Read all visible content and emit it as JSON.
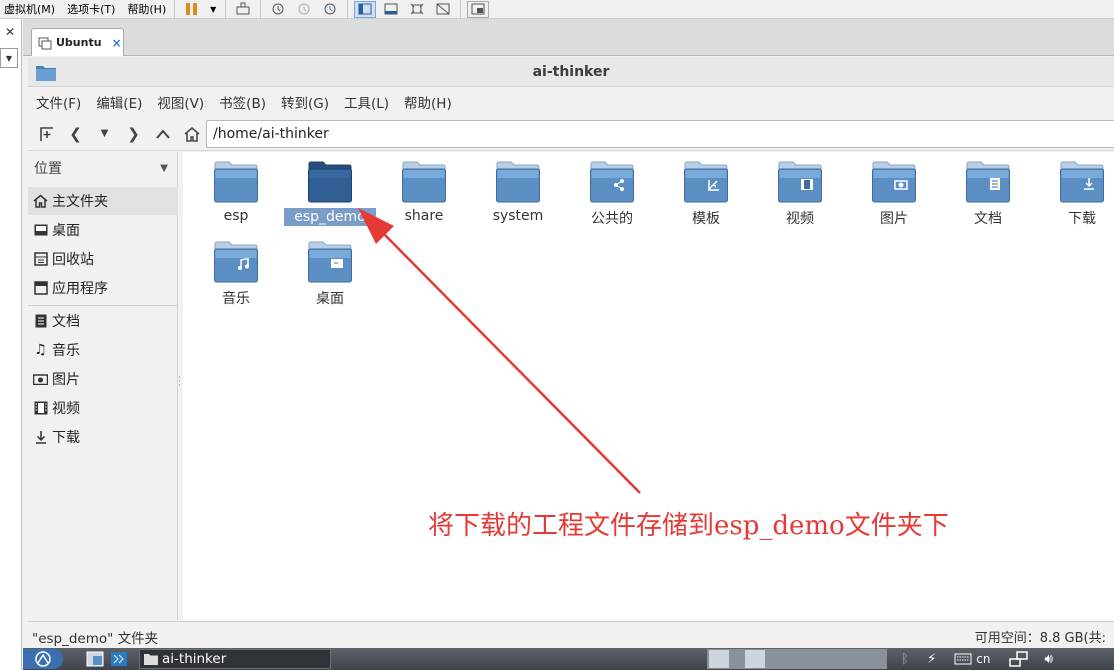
{
  "host": {
    "menu": [
      "虚拟机(M)",
      "选项卡(T)",
      "帮助(H)"
    ]
  },
  "vm_tab": {
    "label": "Ubuntu",
    "close": "×"
  },
  "window": {
    "title": "ai-thinker"
  },
  "menubar": [
    "文件(F)",
    "编辑(E)",
    "视图(V)",
    "书签(B)",
    "转到(G)",
    "工具(L)",
    "帮助(H)"
  ],
  "toolbar": {
    "path": "/home/ai-thinker"
  },
  "sidebar": {
    "header": "位置",
    "places": [
      {
        "label": "主文件夹",
        "icon": "home-icon"
      },
      {
        "label": "桌面",
        "icon": "desktop-icon"
      },
      {
        "label": "回收站",
        "icon": "trash-icon"
      },
      {
        "label": "应用程序",
        "icon": "applications-icon"
      }
    ],
    "bookmarks": [
      {
        "label": "文档",
        "icon": "documents-icon"
      },
      {
        "label": "音乐",
        "icon": "music-icon"
      },
      {
        "label": "图片",
        "icon": "pictures-icon"
      },
      {
        "label": "视频",
        "icon": "videos-icon"
      },
      {
        "label": "下载",
        "icon": "downloads-icon"
      }
    ]
  },
  "files": [
    {
      "label": "esp",
      "emblem": ""
    },
    {
      "label": "esp_demo",
      "emblem": "",
      "selected": true
    },
    {
      "label": "share",
      "emblem": ""
    },
    {
      "label": "system",
      "emblem": ""
    },
    {
      "label": "公共的",
      "emblem": "share-emblem"
    },
    {
      "label": "模板",
      "emblem": "template-emblem"
    },
    {
      "label": "视频",
      "emblem": "video-emblem"
    },
    {
      "label": "图片",
      "emblem": "camera-emblem"
    },
    {
      "label": "文档",
      "emblem": "document-emblem"
    },
    {
      "label": "下载",
      "emblem": "download-emblem"
    },
    {
      "label": "音乐",
      "emblem": "music-emblem"
    },
    {
      "label": "桌面",
      "emblem": "desktop-emblem"
    }
  ],
  "status": {
    "left": "\"esp_demo\" 文件夹",
    "right": "可用空间：8.8 GB(共:"
  },
  "taskbar": {
    "window_label": "ai-thinker",
    "lang": "cn"
  },
  "annotation": {
    "text": "将下载的工程文件存储到esp_demo文件夹下",
    "color": "#e53935"
  },
  "colors": {
    "folder": "#5b8fc4",
    "folder_selected": "#2f5f95",
    "accent": "#7a9cc9"
  }
}
